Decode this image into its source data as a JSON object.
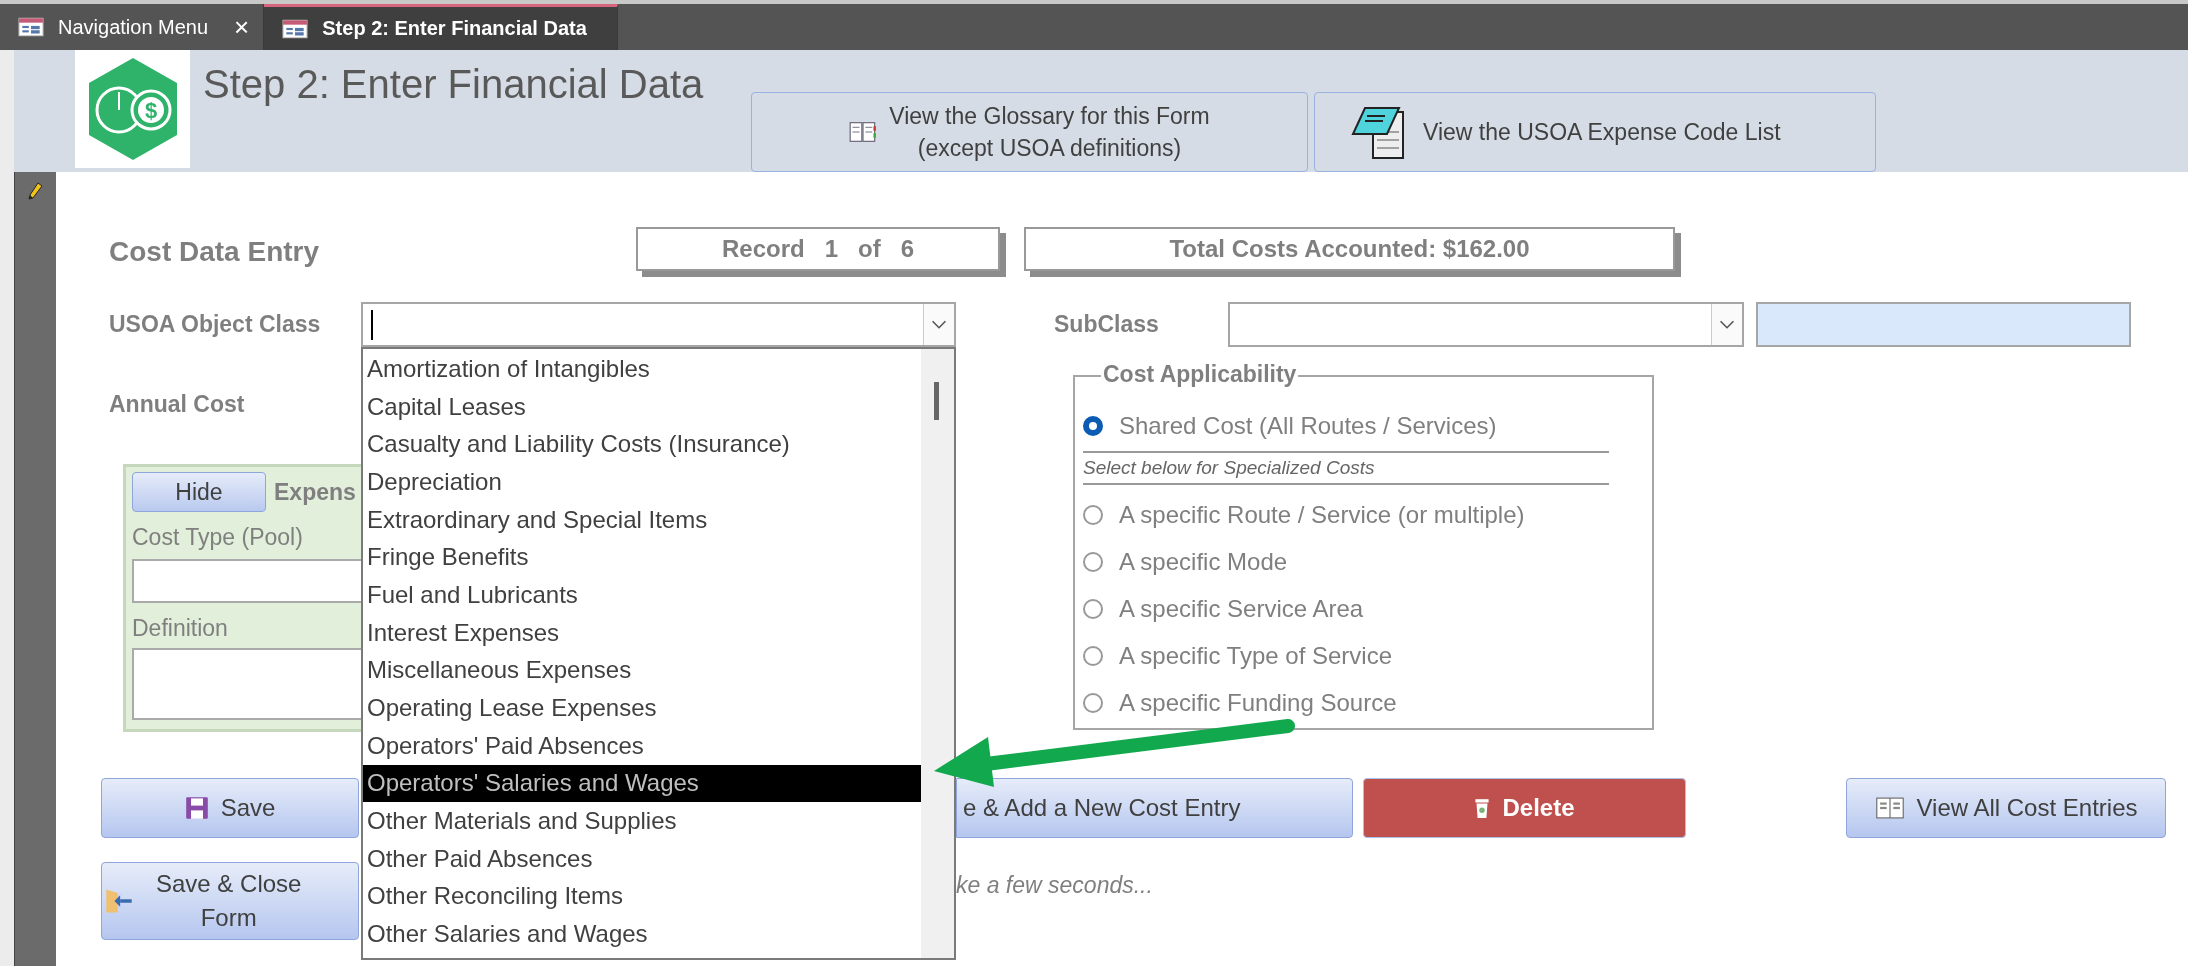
{
  "tabs": [
    {
      "label": "Navigation Menu",
      "selected": false,
      "close": "×"
    },
    {
      "label": "Step 2: Enter Financial Data",
      "selected": true
    }
  ],
  "header": {
    "title": "Step 2: Enter Financial Data",
    "logo_symbol": "$",
    "buttons": [
      {
        "kind": "glossary",
        "lines": [
          "View the Glossary for this Form",
          "(except USOA definitions)"
        ]
      },
      {
        "kind": "codes",
        "lines": [
          "View the USOA Expense Code List"
        ]
      }
    ]
  },
  "form": {
    "section_title": "Cost Data Entry",
    "record": "Record   1   of   6",
    "total": "Total Costs Accounted: $162.00",
    "object_class_label": "USOA Object Class",
    "subclass_label": "SubClass",
    "annual_cost_label": "Annual Cost",
    "expense_panel": {
      "hide_button": "Hide",
      "heading": "Expens",
      "cost_type_label": "Cost Type (Pool)",
      "definition_label": "Definition"
    },
    "cost_applicability": {
      "legend": "Cost Applicability",
      "items": [
        {
          "kind": "radio",
          "label": "Shared Cost (All Routes / Services)",
          "selected": true
        },
        {
          "kind": "note",
          "label": "Select below for Specialized Costs"
        },
        {
          "kind": "radio",
          "label": "A specific Route / Service (or multiple)",
          "selected": false
        },
        {
          "kind": "radio",
          "label": "A specific Mode",
          "selected": false
        },
        {
          "kind": "radio",
          "label": "A specific Service Area",
          "selected": false
        },
        {
          "kind": "radio",
          "label": "A specific Type of Service",
          "selected": false
        },
        {
          "kind": "radio",
          "label": "A specific Funding Source",
          "selected": false
        }
      ]
    },
    "buttons": [
      {
        "kind": "save",
        "label": "Save"
      },
      {
        "kind": "add",
        "label": "e & Add a New Cost Entry"
      },
      {
        "kind": "delete",
        "label": "Delete"
      },
      {
        "kind": "view",
        "label": "View All Cost Entries"
      }
    ],
    "close_button": {
      "lines": [
        "Save & Close",
        "Form"
      ]
    },
    "status_note": "ke a few seconds..."
  },
  "dropdown": {
    "items": [
      {
        "label": "Amortization of Intangibles",
        "selected": false
      },
      {
        "label": "Capital Leases",
        "selected": false
      },
      {
        "label": "Casualty and Liability Costs (Insurance)",
        "selected": false
      },
      {
        "label": "Depreciation",
        "selected": false
      },
      {
        "label": "Extraordinary and Special Items",
        "selected": false
      },
      {
        "label": "Fringe Benefits",
        "selected": false
      },
      {
        "label": "Fuel and Lubricants",
        "selected": false
      },
      {
        "label": "Interest Expenses",
        "selected": false
      },
      {
        "label": "Miscellaneous Expenses",
        "selected": false
      },
      {
        "label": "Operating Lease Expenses",
        "selected": false
      },
      {
        "label": "Operators' Paid Absences",
        "selected": false
      },
      {
        "label": "Operators' Salaries and Wages",
        "selected": true
      },
      {
        "label": "Other Materials and Supplies",
        "selected": false
      },
      {
        "label": "Other Paid Absences",
        "selected": false
      },
      {
        "label": "Other Reconciling Items",
        "selected": false
      },
      {
        "label": "Other Salaries and Wages",
        "selected": false
      }
    ]
  }
}
